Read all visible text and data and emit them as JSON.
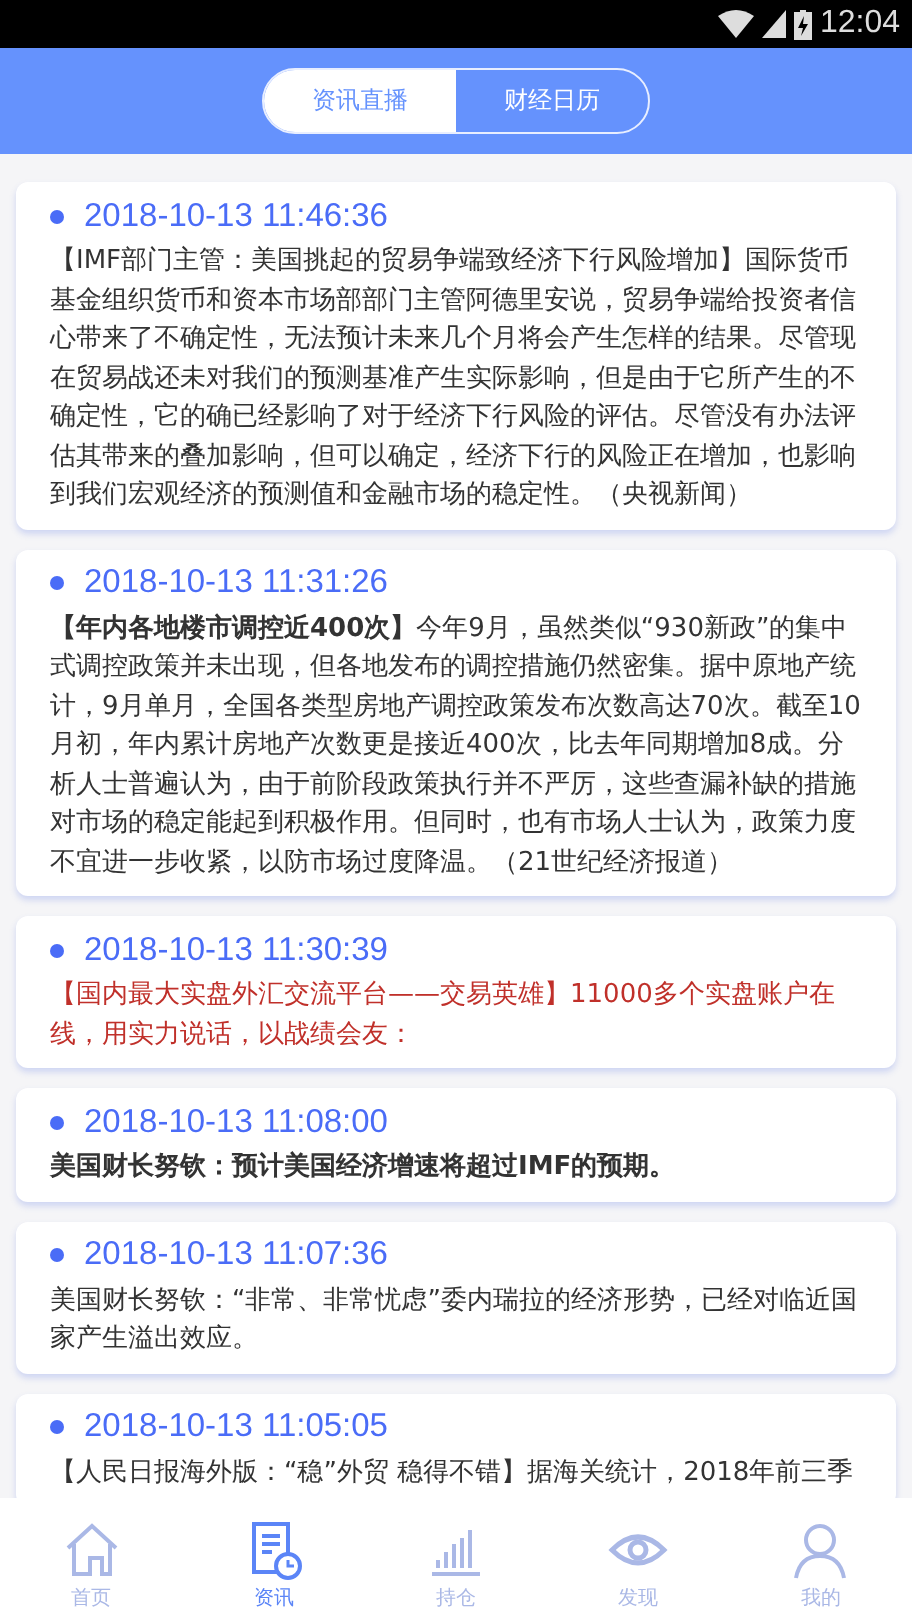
{
  "status_bar": {
    "time": "12:04"
  },
  "tabs": [
    {
      "label": "资讯直播",
      "selected": true
    },
    {
      "label": "财经日历",
      "selected": false
    }
  ],
  "news": [
    {
      "time": "2018-10-13 11:46:36",
      "kind": "normal",
      "bold": false,
      "text": "【IMF部门主管：美国挑起的贸易争端致经济下行风险增加】国际货币基金组织货币和资本市场部部门主管阿德里安说，贸易争端给投资者信心带来了不确定性，无法预计未来几个月将会产生怎样的结果。尽管现在贸易战还未对我们的预测基准产生实际影响，但是由于它所产生的不确定性，它的确已经影响了对于经济下行风险的评估。尽管没有办法评估其带来的叠加影响，但可以确定，经济下行的风险正在增加，也影响到我们宏观经济的预测值和金融市场的稳定性。（央视新闻）"
    },
    {
      "time": "2018-10-13 11:31:26",
      "kind": "normal",
      "bold": false,
      "text": "**【年内各地楼市调控近400次】**今年9月，虽然类似“930新政”的集中式调控政策并未出现，但各地发布的调控措施仍然密集。据中原地产统计，9月单月，全国各类型房地产调控政策发布次数高达70次。截至10月初，年内累计房地产次数更是接近400次，比去年同期增加8成。分析人士普遍认为，由于前阶段政策执行并不严厉，这些查漏补缺的措施对市场的稳定能起到积极作用。但同时，也有市场人士认为，政策力度不宜进一步收紧，以防市场过度降温。（21世纪经济报道）"
    },
    {
      "time": "2018-10-13 11:30:39",
      "kind": "promo",
      "bold": false,
      "text": "【国内最大实盘外汇交流平台——交易英雄】11000多个实盘账户在线，用实力说话，以战绩会友："
    },
    {
      "time": "2018-10-13 11:08:00",
      "kind": "normal",
      "bold": true,
      "text": "美国财长努钦：预计美国经济增速将超过IMF的预期。"
    },
    {
      "time": "2018-10-13 11:07:36",
      "kind": "normal",
      "bold": false,
      "text": "美国财长努钦：“非常、非常忧虑”委内瑞拉的经济形势，已经对临近国家产生溢出效应。"
    },
    {
      "time": "2018-10-13 11:05:05",
      "kind": "normal",
      "bold": false,
      "text": "【人民日报海外版：“稳”外贸 稳得不错】据海关统计，2018年前三季"
    }
  ],
  "nav": [
    {
      "label": "首页",
      "kind": "home",
      "selected": false
    },
    {
      "label": "资讯",
      "kind": "news",
      "selected": true
    },
    {
      "label": "持仓",
      "kind": "chart",
      "selected": false
    },
    {
      "label": "发现",
      "kind": "eye",
      "selected": false
    },
    {
      "label": "我的",
      "kind": "user",
      "selected": false
    }
  ]
}
